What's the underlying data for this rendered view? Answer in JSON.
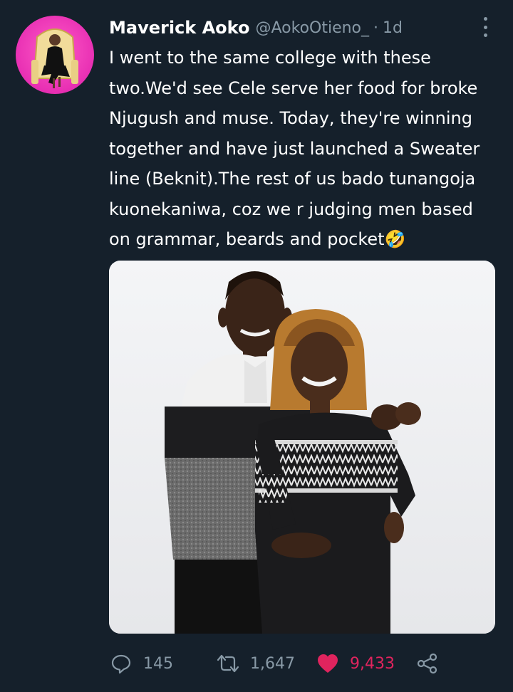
{
  "tweet": {
    "author_name": "Maverick Aoko",
    "author_handle": "@AokoOtieno_",
    "separator": "·",
    "time": "1d",
    "text": "I went to the same college with these\ntwo.We'd see Cele serve her food for broke\nNjugush and muse. Today, they're winning\ntogether and have just launched a Sweater\nline (Beknit).The rest of us bado tunangoja\nkuonekaniwa, coz we r judging men based\non grammar, beards and pocket🤣"
  },
  "actions": {
    "replies": "145",
    "retweets": "1,647",
    "likes": "9,433"
  },
  "icons": {
    "reply": "reply-icon",
    "retweet": "retweet-icon",
    "like": "heart-icon",
    "share": "share-icon",
    "more": "more-options-icon"
  },
  "colors": {
    "background": "#15202b",
    "muted": "#8899a6",
    "like": "#e0245e",
    "avatar_bg": "#e82fb3"
  }
}
